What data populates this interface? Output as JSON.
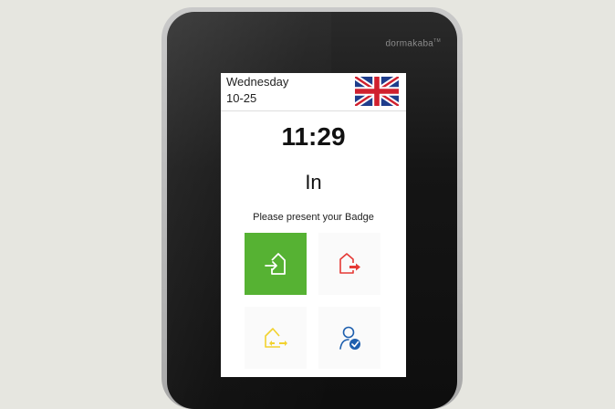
{
  "device": {
    "brand": "dormakaba",
    "brand_mark": "TM"
  },
  "header": {
    "day": "Wednesday",
    "date": "10-25",
    "language_flag": "uk-flag-icon"
  },
  "clock": {
    "time": "11:29"
  },
  "status": {
    "mode": "In",
    "prompt": "Please present your Badge"
  },
  "actions": [
    {
      "icon": "clock-in-icon",
      "selected": true,
      "color": "#56b233"
    },
    {
      "icon": "clock-out-icon",
      "selected": false,
      "color": "#e53935"
    },
    {
      "icon": "transfer-icon",
      "selected": false,
      "color": "#f2d22e"
    },
    {
      "icon": "user-status-icon",
      "selected": false,
      "color": "#1e5fae"
    }
  ]
}
